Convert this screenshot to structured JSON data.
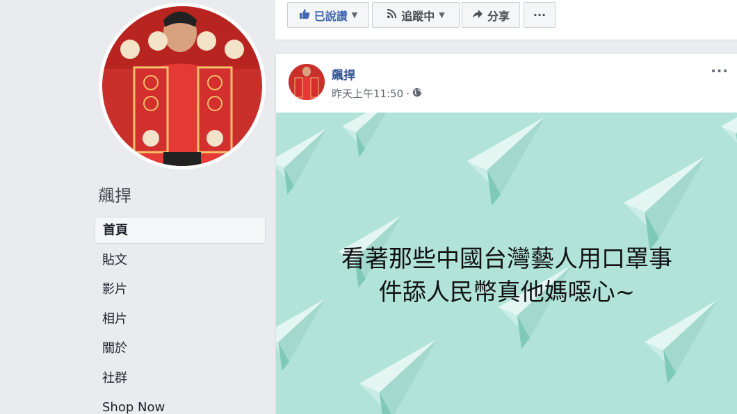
{
  "page": {
    "name": "飆捍",
    "nav": [
      {
        "label": "首頁",
        "active": true
      },
      {
        "label": "貼文"
      },
      {
        "label": "影片"
      },
      {
        "label": "相片"
      },
      {
        "label": "關於"
      },
      {
        "label": "社群"
      },
      {
        "label": "Shop Now"
      }
    ]
  },
  "actions": {
    "liked": "已說讚",
    "following": "追蹤中",
    "share": "分享",
    "more": "···"
  },
  "post": {
    "author": "飆捍",
    "time": "昨天上午11:50",
    "separator": "·",
    "more": "···",
    "image_text": [
      "看著那些中國台灣藝人用口罩事",
      "件舔人民幣真他媽噁心~"
    ]
  },
  "colors": {
    "image_bg": "#b1e3d9",
    "link": "#385898",
    "liked": "#4267b2"
  }
}
